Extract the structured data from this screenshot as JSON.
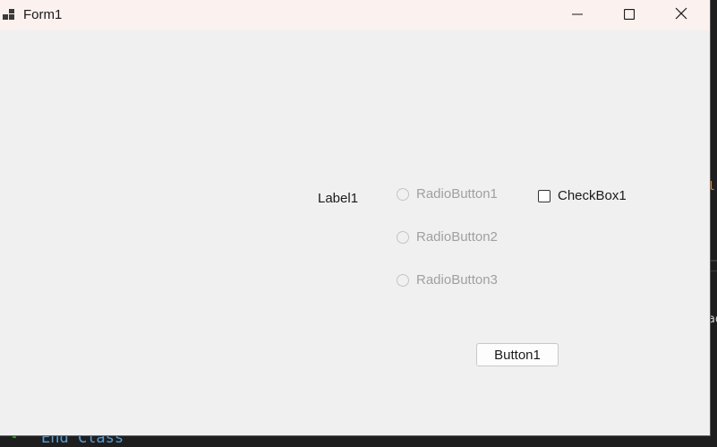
{
  "window": {
    "title": "Form1",
    "controls": {
      "minimize_icon": "minimize-icon",
      "maximize_icon": "maximize-icon",
      "close_icon": "close-icon"
    }
  },
  "form": {
    "label1": "Label1",
    "radio_buttons": [
      {
        "label": "RadioButton1",
        "checked": false,
        "enabled": false
      },
      {
        "label": "RadioButton2",
        "checked": false,
        "enabled": false
      },
      {
        "label": "RadioButton3",
        "checked": false,
        "enabled": false
      }
    ],
    "checkbox": {
      "label": "CheckBox1",
      "checked": false
    },
    "button": {
      "label": "Button1"
    }
  },
  "background_editor": {
    "bottom_text": "End Class",
    "right_fragment_1": "l-",
    "right_fragment_2": "ad"
  },
  "colors": {
    "titlebar": "#fbf1ee",
    "client": "#f0f0f0",
    "disabled_text": "#a0a0a0",
    "editor_bg": "#1f1f1f"
  }
}
